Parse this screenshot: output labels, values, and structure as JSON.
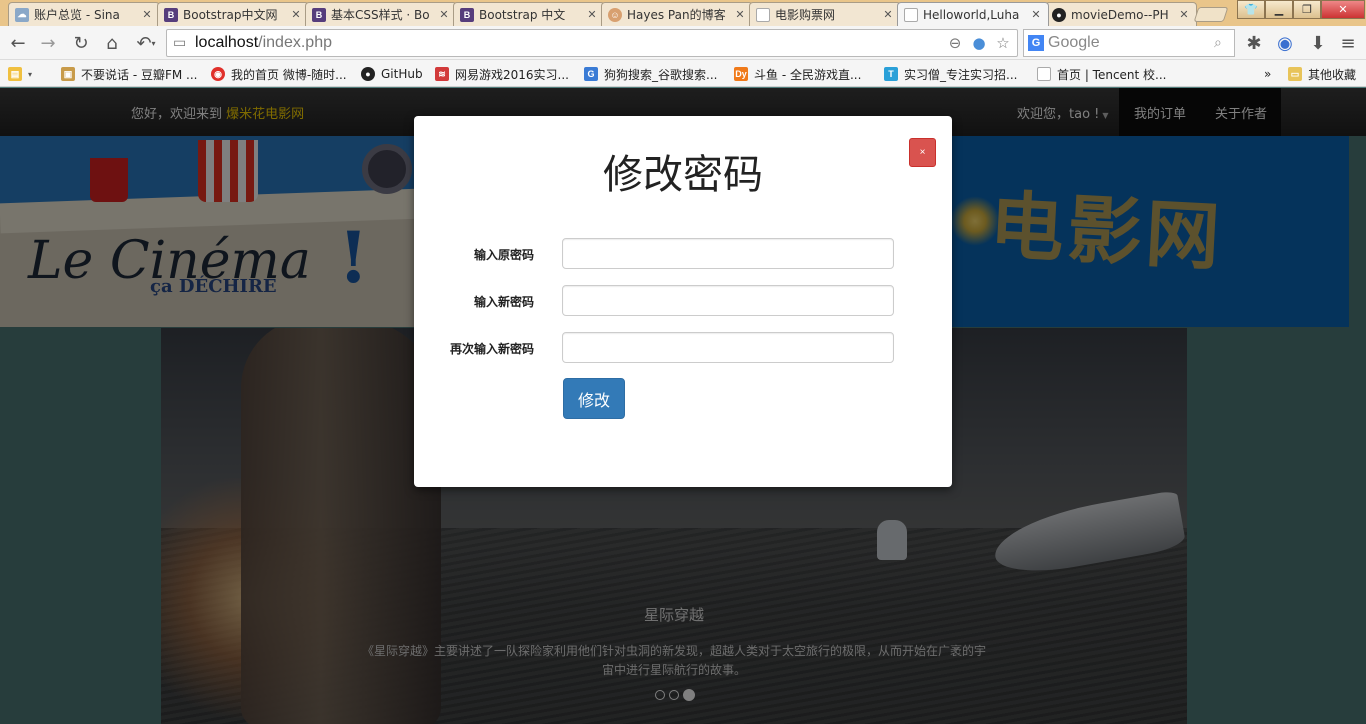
{
  "browser": {
    "tabs": [
      {
        "title": "账户总览 - Sina",
        "icon": "cloud-icon",
        "color": "#8aa8c8"
      },
      {
        "title": "Bootstrap中文网",
        "icon": "bootstrap-icon",
        "color": "#563d7c"
      },
      {
        "title": "基本CSS样式 · Bo",
        "icon": "bootstrap-icon",
        "color": "#563d7c"
      },
      {
        "title": "Bootstrap 中文",
        "icon": "bootstrap-icon",
        "color": "#563d7c"
      },
      {
        "title": "Hayes Pan的博客",
        "icon": "avatar-icon",
        "color": "#d8a070"
      },
      {
        "title": "电影购票网",
        "icon": "page-icon",
        "color": "#cccccc"
      },
      {
        "title": "Helloworld,Luha",
        "icon": "page-icon",
        "color": "#cccccc"
      },
      {
        "title": "movieDemo--PH",
        "icon": "github-icon",
        "color": "#222222"
      }
    ],
    "active_tab": 6,
    "url_host": "localhost",
    "url_path": "/index.php",
    "search_engine_text": "Google",
    "bookmarks": [
      {
        "label": "不要说话 - 豆瓣FM ...",
        "icon": "douban-icon",
        "color": "#c89b4a"
      },
      {
        "label": "我的首页 微博-随时...",
        "icon": "weibo-icon",
        "color": "#e0302a"
      },
      {
        "label": "GitHub",
        "icon": "github-icon",
        "color": "#222222"
      },
      {
        "label": "网易游戏2016实习...",
        "icon": "netease-icon",
        "color": "#d23a3a"
      },
      {
        "label": "狗狗搜索_谷歌搜索...",
        "icon": "g-search-icon",
        "color": "#3a7bd5"
      },
      {
        "label": "斗鱼 - 全民游戏直...",
        "icon": "douyu-icon",
        "color": "#f07a1a"
      },
      {
        "label": "实习僧_专注实习招...",
        "icon": "shixiseng-icon",
        "color": "#2aa0d8"
      },
      {
        "label": "首页 | Tencent 校...",
        "icon": "page-icon",
        "color": "#bbbbbb"
      }
    ],
    "bookmarks_more": "»",
    "other_bookmarks": "其他收藏"
  },
  "site": {
    "welcome_prefix": "您好，欢迎来到",
    "brand": "爆米花电影网",
    "user_greeting": "欢迎您，tao !",
    "nav_orders": "我的订单",
    "nav_about": "关于作者",
    "banner_cinema": "Le Cinéma",
    "banner_sub": "ça DÉCHIRE",
    "banner_bang": "!",
    "banner_title": "电影网"
  },
  "carousel": {
    "title": "星际穿越",
    "text": "《星际穿越》主要讲述了一队探险家利用他们针对虫洞的新发现，超越人类对于太空旅行的极限，从而开始在广袤的宇宙中进行星际航行的故事。",
    "slide_count": 3,
    "active_slide": 3
  },
  "modal": {
    "title": "修改密码",
    "close_label": "×",
    "fields": [
      {
        "label": "输入原密码",
        "value": ""
      },
      {
        "label": "输入新密码",
        "value": ""
      },
      {
        "label": "再次输入新密码",
        "value": ""
      }
    ],
    "submit_label": "修改"
  }
}
